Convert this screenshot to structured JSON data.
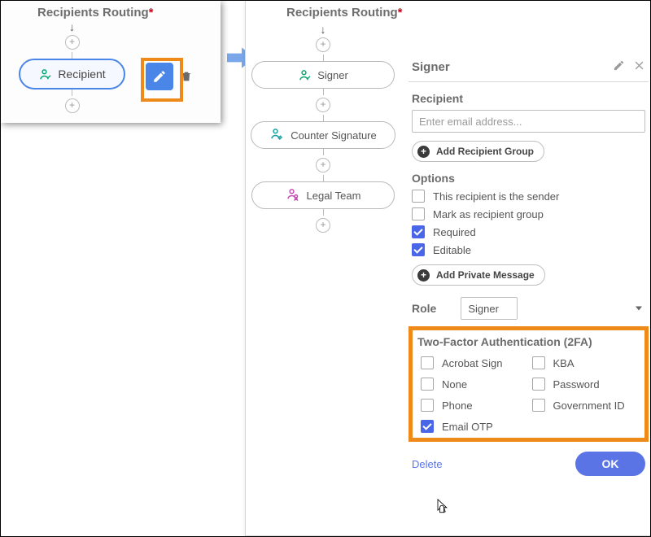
{
  "title": "Recipients Routing",
  "left": {
    "node_label": "Recipient"
  },
  "right_flow": {
    "n1": "Signer",
    "n2": "Counter Signature",
    "n3": "Legal Team"
  },
  "panel": {
    "title": "Signer",
    "recipient_label": "Recipient",
    "email_placeholder": "Enter email address...",
    "add_group_label": "Add Recipient Group",
    "options_label": "Options",
    "opt_sender": "This recipient is the sender",
    "opt_markgroup": "Mark as recipient group",
    "opt_required": "Required",
    "opt_editable": "Editable",
    "add_private_label": "Add Private Message",
    "role_label": "Role",
    "role_value": "Signer",
    "tfa_label": "Two-Factor Authentication (2FA)",
    "tfa": {
      "acrobat": "Acrobat Sign",
      "kba": "KBA",
      "none": "None",
      "password": "Password",
      "phone": "Phone",
      "govid": "Government ID",
      "emailotp": "Email OTP"
    },
    "delete_label": "Delete",
    "ok_label": "OK"
  }
}
